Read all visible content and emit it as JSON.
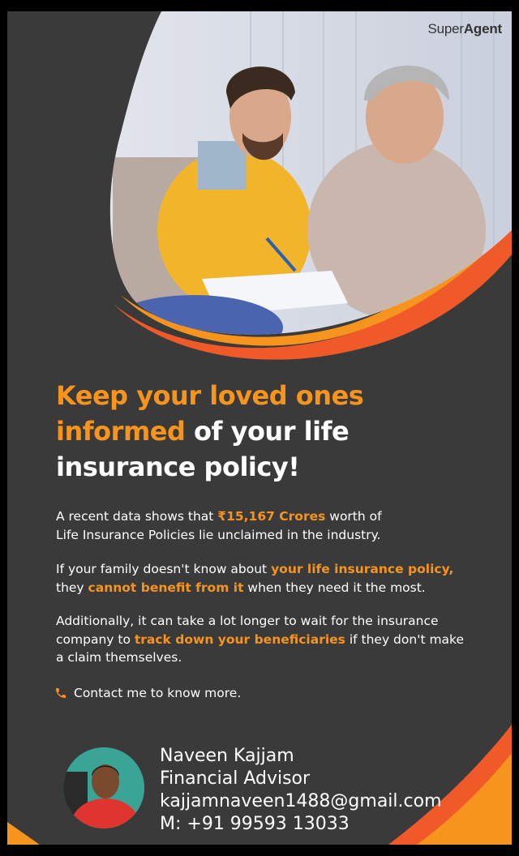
{
  "brand": {
    "super": "Super",
    "agent": "Agent"
  },
  "headline": {
    "part1": "Keep your loved ones",
    "part2": "informed",
    "part3": " of your life",
    "part4": "insurance policy!"
  },
  "paragraphs": {
    "p1": {
      "a": "A recent data shows that ",
      "hl": "₹15,167 Crores",
      "b": " worth of",
      "c": "Life Insurance Policies lie unclaimed in the industry."
    },
    "p2": {
      "a": "If your family doesn't know about ",
      "hl1": "your life insurance policy,",
      "b": "they ",
      "hl2": "cannot benefit from it",
      "c": " when they need it the most."
    },
    "p3": {
      "a": "Additionally, it can take a lot longer to wait for the insurance",
      "b": "company to ",
      "hl": "track down your beneficiaries",
      "c": " if they don't make",
      "d": "a claim themselves."
    }
  },
  "contact": {
    "text": "Contact me to know more.",
    "icon": "phone-icon"
  },
  "advisor": {
    "name": "Naveen Kajjam",
    "title": "Financial Advisor",
    "email": "kajjamnaveen1488@gmail.com",
    "phone": "M: +91 99593 13033"
  },
  "colors": {
    "background": "#3a3a3a",
    "accent": "#f7941d",
    "accent_dark": "#f05a28",
    "text": "#ffffff"
  }
}
